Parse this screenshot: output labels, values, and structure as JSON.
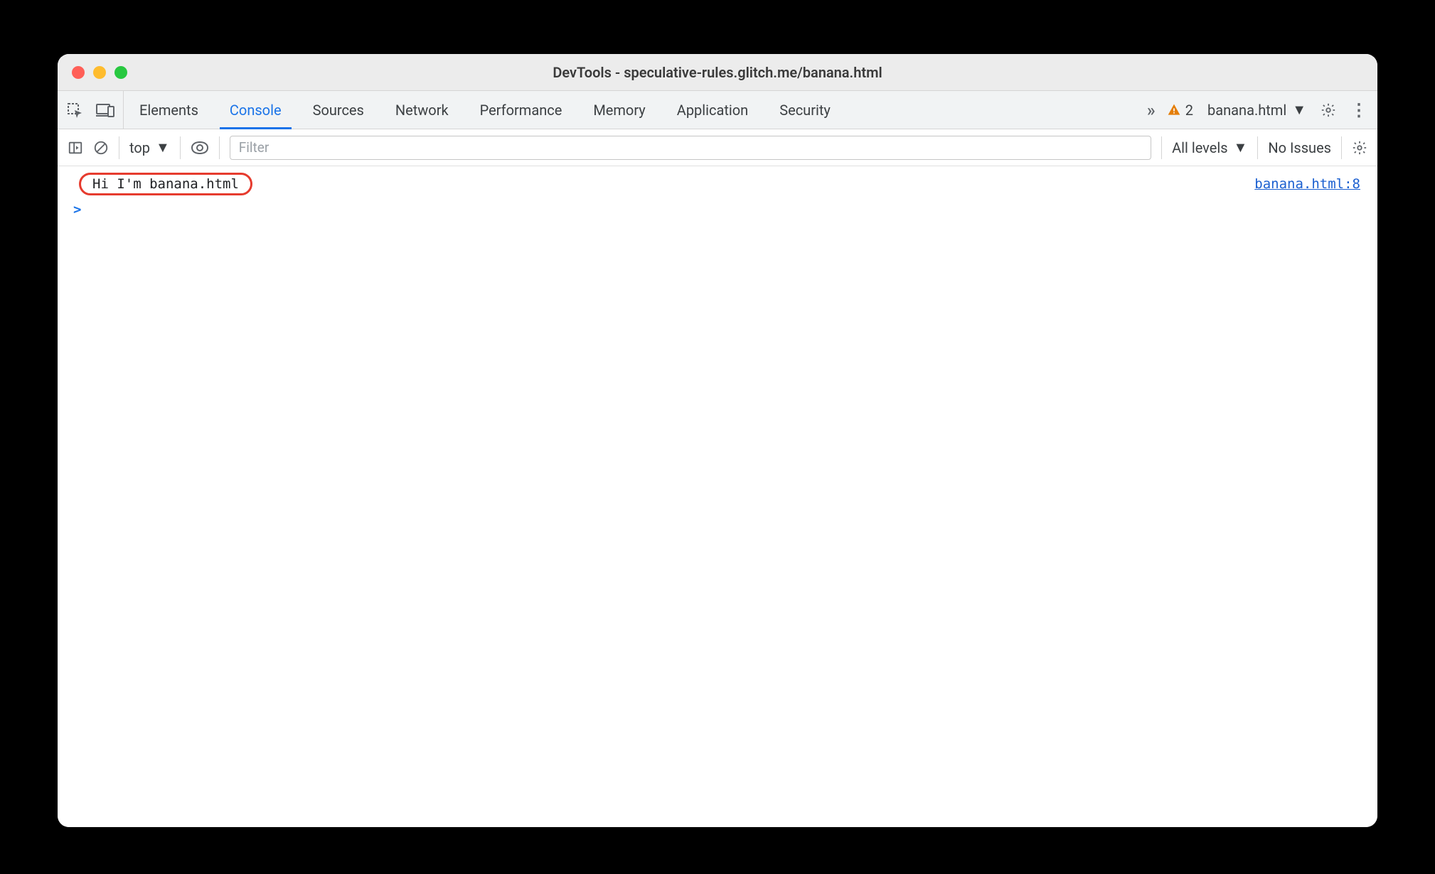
{
  "titlebar": {
    "title": "DevTools - speculative-rules.glitch.me/banana.html"
  },
  "tabs": {
    "items": [
      {
        "label": "Elements"
      },
      {
        "label": "Console"
      },
      {
        "label": "Sources"
      },
      {
        "label": "Network"
      },
      {
        "label": "Performance"
      },
      {
        "label": "Memory"
      },
      {
        "label": "Application"
      },
      {
        "label": "Security"
      }
    ],
    "active_index": 1,
    "warning_count": "2",
    "frame_selector": "banana.html"
  },
  "filter": {
    "context": "top",
    "placeholder": "Filter",
    "levels_label": "All levels",
    "issues_label": "No Issues"
  },
  "console": {
    "log_message": "Hi I'm banana.html",
    "log_source": "banana.html:8",
    "prompt": ">"
  }
}
